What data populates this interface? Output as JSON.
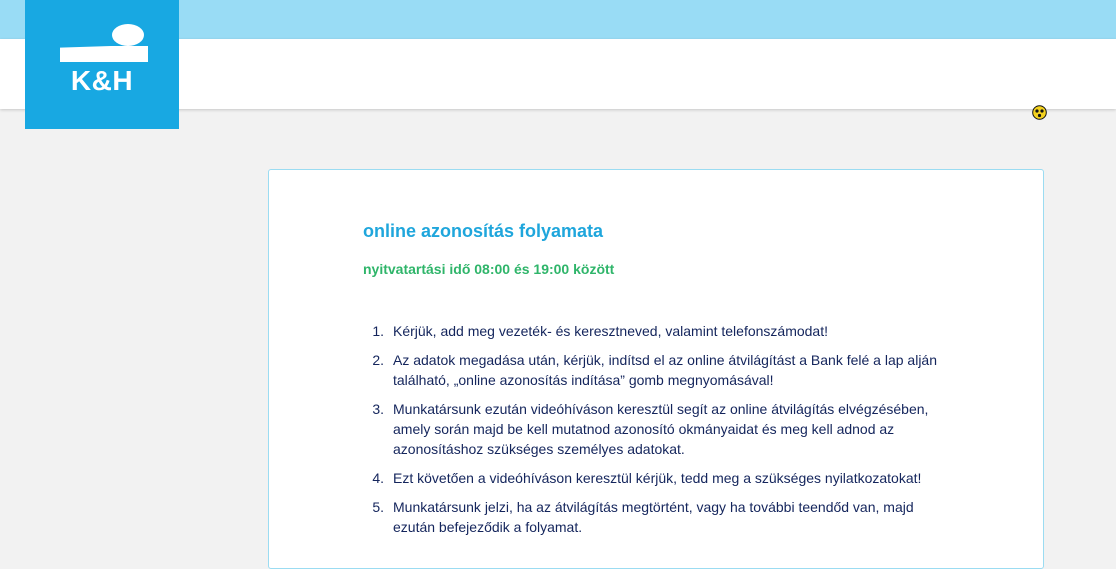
{
  "brand": {
    "logo_text": "K&H",
    "colors": {
      "top_bar": "#99dcf5",
      "logo_bg": "#18a8e2",
      "title": "#1fa6dc",
      "subtitle": "#2fb56a",
      "body_text": "#14255c",
      "card_border": "#9bdcf2",
      "page_bg": "#f2f2f2"
    }
  },
  "header": {
    "accessibility_icon": "low-vision-accessibility-icon"
  },
  "content": {
    "title": "online azonosítás folyamata",
    "subtitle": "nyitvatartási idő 08:00 és 19:00 között",
    "steps": [
      {
        "number": "1.",
        "text": "Kérjük, add meg vezeték- és keresztneved, valamint telefonszámodat!"
      },
      {
        "number": "2.",
        "text": "Az adatok megadása után, kérjük, indítsd el az online átvilágítást a Bank felé a lap alján található, „online azonosítás indítása” gomb megnyomásával!"
      },
      {
        "number": "3.",
        "text": "Munkatársunk ezután videóhíváson keresztül segít az online átvilágítás elvégzésében, amely során majd be kell mutatnod azonosító okmányaidat és meg kell adnod az azonosításhoz szükséges személyes adatokat."
      },
      {
        "number": "4.",
        "text": "Ezt követően a videóhíváson keresztül kérjük, tedd meg a szükséges nyilatkozatokat!"
      },
      {
        "number": "5.",
        "text": "Munkatársunk jelzi, ha az átvilágítás megtörtént, vagy ha további teendőd van, majd ezután befejeződik a folyamat."
      }
    ]
  }
}
